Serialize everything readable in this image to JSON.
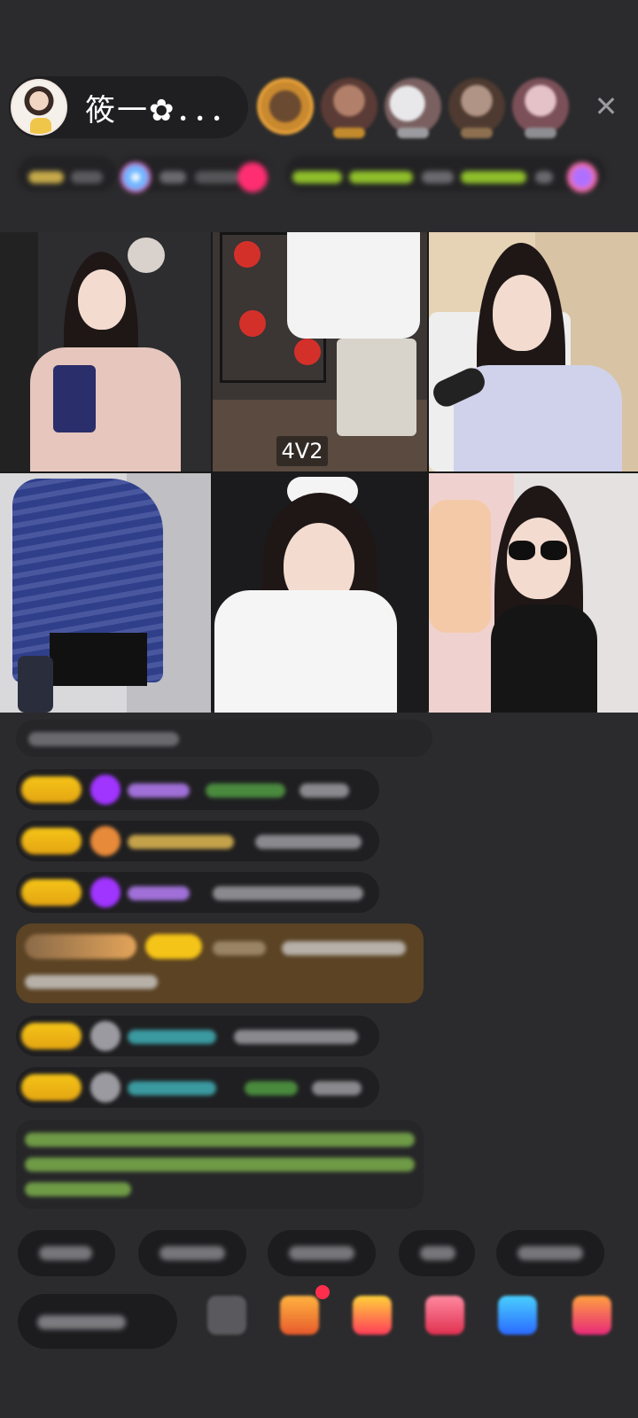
{
  "host": {
    "name": "筱一✿．．．"
  },
  "viewers": [
    {
      "icon": "viewer-avatar"
    },
    {
      "icon": "viewer-avatar"
    },
    {
      "icon": "viewer-avatar"
    },
    {
      "icon": "viewer-avatar"
    },
    {
      "icon": "viewer-avatar"
    }
  ],
  "close_label": "✕",
  "grid": {
    "tag": "4V2"
  },
  "colors": {
    "background": "#2b2b2d",
    "pill": "#1f1f21",
    "level_badge": "#f5c418",
    "highlight_msg": "#5b4324",
    "system_text": "#8fd05c"
  }
}
